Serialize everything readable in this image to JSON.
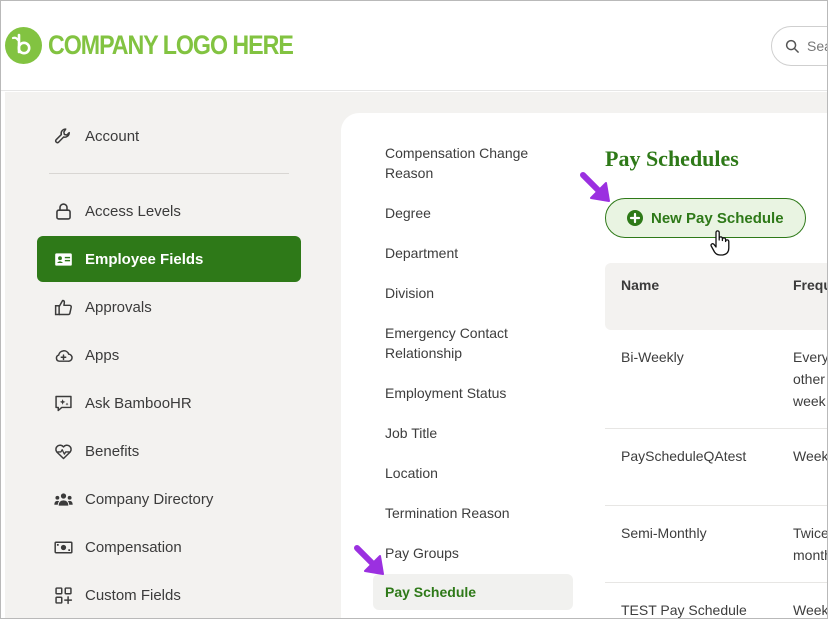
{
  "header": {
    "logo_text": "COMPANY LOGO HERE",
    "search_placeholder": "Sea"
  },
  "sidebar": {
    "items": [
      {
        "label": "Account",
        "icon": "wrench-icon"
      },
      {
        "label": "Access Levels",
        "icon": "lock-icon"
      },
      {
        "label": "Employee Fields",
        "icon": "id-card-icon",
        "active": true
      },
      {
        "label": "Approvals",
        "icon": "thumbs-up-icon"
      },
      {
        "label": "Apps",
        "icon": "cloud-plus-icon"
      },
      {
        "label": "Ask BambooHR",
        "icon": "chat-sparkle-icon"
      },
      {
        "label": "Benefits",
        "icon": "heart-pulse-icon"
      },
      {
        "label": "Company Directory",
        "icon": "people-icon"
      },
      {
        "label": "Compensation",
        "icon": "money-icon"
      },
      {
        "label": "Custom Fields",
        "icon": "grid-plus-icon"
      }
    ]
  },
  "submenu": {
    "items": [
      {
        "label": "Compensation Change Reason"
      },
      {
        "label": "Degree"
      },
      {
        "label": "Department"
      },
      {
        "label": "Division"
      },
      {
        "label": "Emergency Contact Relationship"
      },
      {
        "label": "Employment Status"
      },
      {
        "label": "Job Title"
      },
      {
        "label": "Location"
      },
      {
        "label": "Termination Reason"
      },
      {
        "label": "Pay Groups"
      },
      {
        "label": "Pay Schedule",
        "active": true
      }
    ]
  },
  "content": {
    "title": "Pay Schedules",
    "new_button": "New Pay Schedule",
    "table": {
      "columns": [
        "Name",
        "Frequ"
      ],
      "rows": [
        {
          "name": "Bi-Weekly",
          "freq": [
            "Every",
            "other",
            "week"
          ]
        },
        {
          "name": "PayScheduleQAtest",
          "freq": [
            "Week"
          ]
        },
        {
          "name": "Semi-Monthly",
          "freq": [
            "Twice",
            "month"
          ]
        },
        {
          "name": "TEST Pay Schedule",
          "freq": [
            "Week"
          ]
        }
      ]
    }
  },
  "colors": {
    "brand_green": "#2e7918",
    "logo_green": "#82c341",
    "annotation_arrow": "#9b30e0"
  }
}
